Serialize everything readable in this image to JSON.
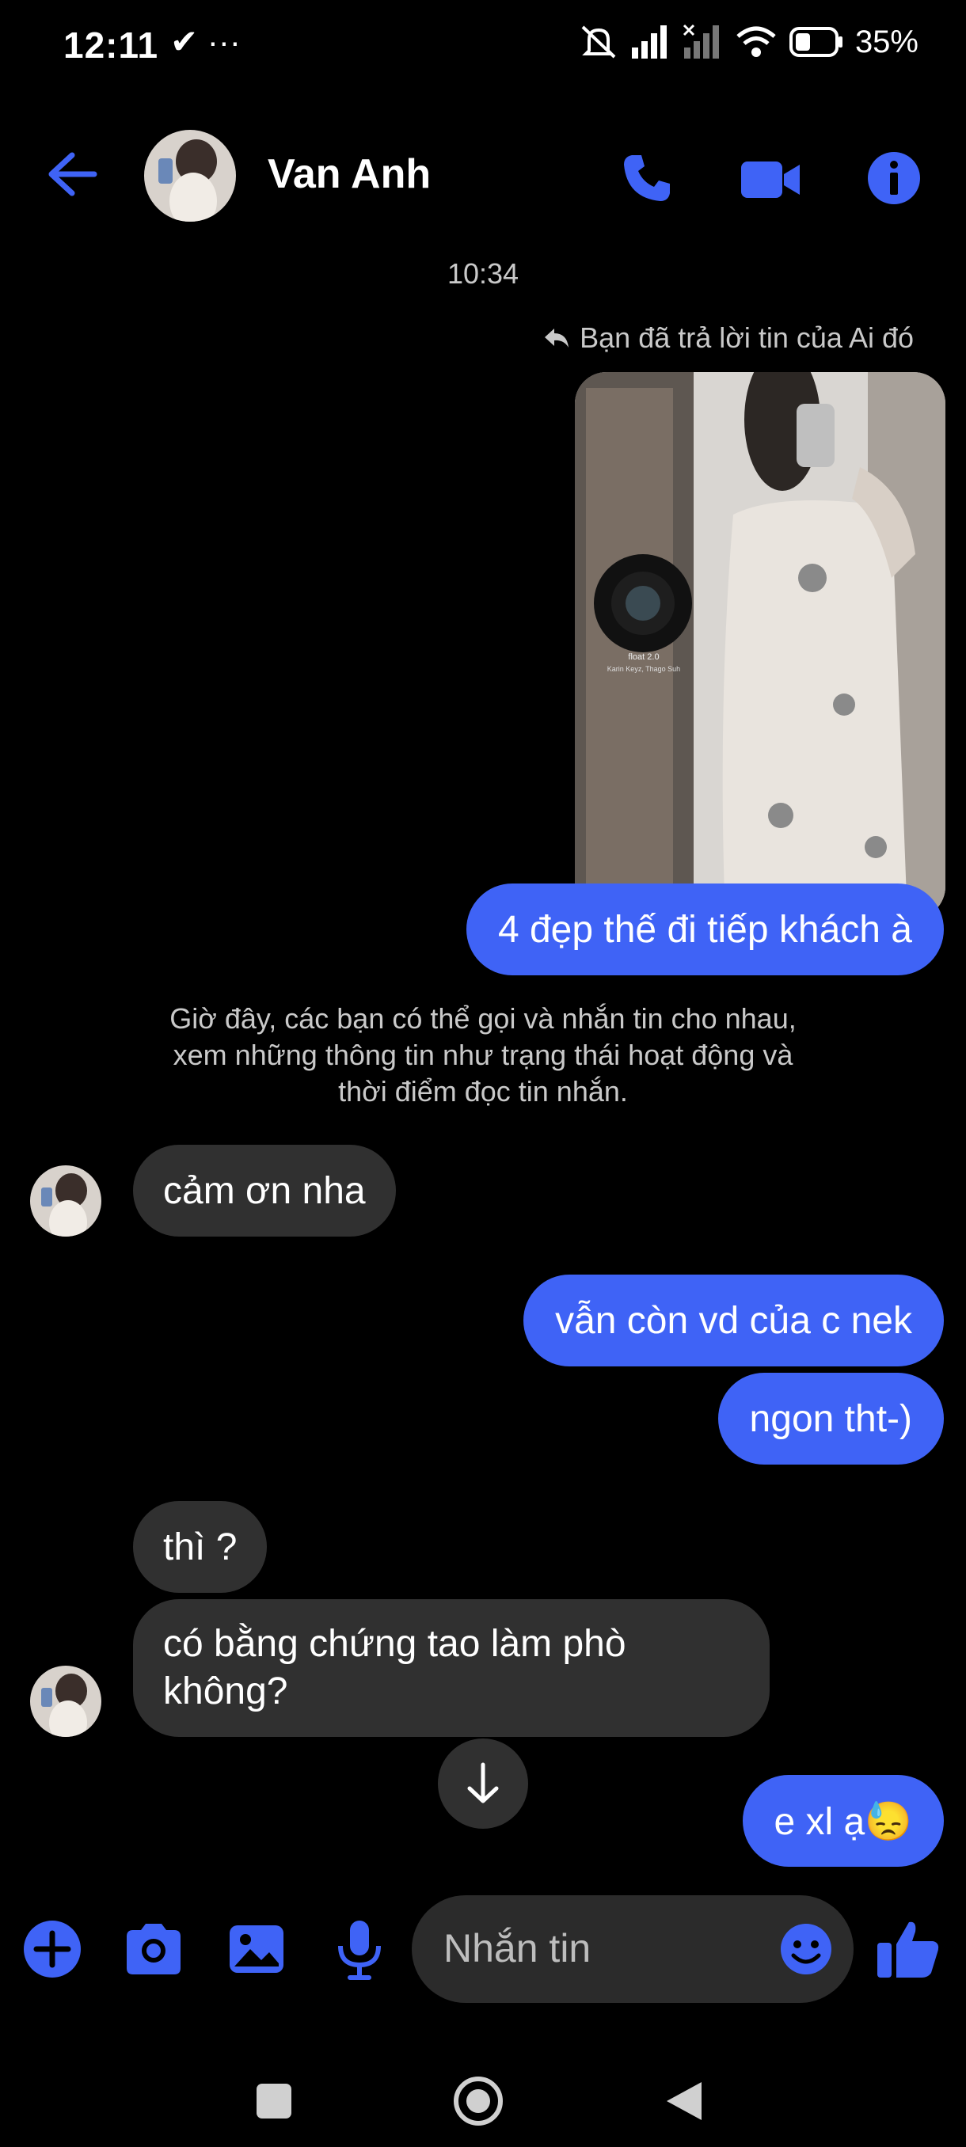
{
  "status_bar": {
    "time": "12:11",
    "left_icons": "✔ ···",
    "battery": "35%",
    "network_icons": [
      "mute-icon",
      "signal-icon",
      "no-signal-icon",
      "wifi-icon",
      "battery-icon"
    ]
  },
  "header": {
    "contact_name": "Van Anh",
    "icons": [
      "back-arrow-icon",
      "phone-icon",
      "video-icon",
      "info-icon"
    ],
    "accent": "#3f63f6"
  },
  "chat": {
    "timestamp": "10:34",
    "reply_note": "Bạn đã trả lời tin của Ai đó",
    "photo_caption_title": "float 2.0",
    "photo_caption_sub": "Karin Keyz, Thago Suh",
    "messages": [
      {
        "from": "me",
        "text": "4 đẹp thế đi tiếp khách à"
      },
      {
        "from": "system",
        "lines": [
          "Giờ đây, các bạn có thể gọi và nhắn tin cho nhau,",
          "xem những thông tin như trạng thái hoạt động và",
          "thời điểm đọc tin nhắn."
        ]
      },
      {
        "from": "them",
        "text": "cảm ơn nha"
      },
      {
        "from": "me",
        "text": "vẫn còn vd của c nek"
      },
      {
        "from": "me",
        "text": "ngon tht-)"
      },
      {
        "from": "them",
        "text": "thì ?"
      },
      {
        "from": "them",
        "lines": [
          "có bằng chứng tao làm phò",
          "không?"
        ]
      },
      {
        "from": "me",
        "text": "e xl ạ😓"
      }
    ]
  },
  "composer": {
    "placeholder": "Nhắn tin",
    "tools": [
      "plus-icon",
      "camera-icon",
      "image-icon",
      "mic-icon",
      "emoji-icon",
      "like-icon"
    ]
  },
  "nav_bar": [
    "recents-button",
    "home-button",
    "back-button"
  ]
}
